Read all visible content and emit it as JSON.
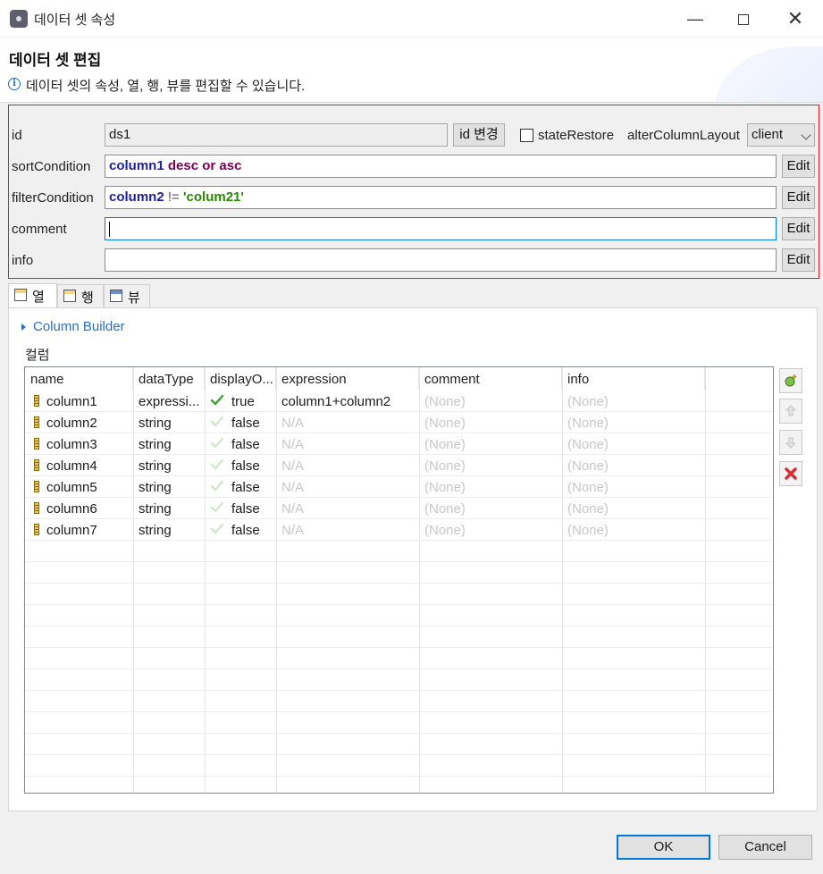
{
  "window": {
    "title": "데이터 셋 속성"
  },
  "header": {
    "title": "데이터 셋 편집",
    "description": "데이터 셋의 속성, 열, 행, 뷰를 편집할 수 있습니다."
  },
  "props": {
    "id_label": "id",
    "id_value": "ds1",
    "id_change_button": "id 변경",
    "state_restore_label": "stateRestore",
    "state_restore_checked": false,
    "alter_column_layout_label": "alterColumnLayout",
    "alter_column_layout_value": "client",
    "sort_label": "sortCondition",
    "sort_tokens": {
      "col": "column1",
      "desc": "desc",
      "or": "or",
      "asc": "asc"
    },
    "filter_label": "filterCondition",
    "filter_tokens": {
      "col": "column2",
      "op": "!=",
      "val": "'colum21'"
    },
    "comment_label": "comment",
    "comment_value": "",
    "info_label": "info",
    "info_value": "",
    "edit_button": "Edit"
  },
  "tabs": [
    {
      "label": "열",
      "active": true
    },
    {
      "label": "행",
      "active": false
    },
    {
      "label": "뷰",
      "active": false
    }
  ],
  "columns_panel": {
    "builder_label": "Column Builder",
    "group_label": "컬럼",
    "headers": [
      "name",
      "dataType",
      "displayO...",
      "expression",
      "comment",
      "info"
    ],
    "rows": [
      {
        "name": "column1",
        "dataType": "expressi...",
        "display": "true",
        "expression": "column1+column2",
        "comment": "(None)",
        "info": "(None)"
      },
      {
        "name": "column2",
        "dataType": "string",
        "display": "false",
        "expression": "N/A",
        "comment": "(None)",
        "info": "(None)"
      },
      {
        "name": "column3",
        "dataType": "string",
        "display": "false",
        "expression": "N/A",
        "comment": "(None)",
        "info": "(None)"
      },
      {
        "name": "column4",
        "dataType": "string",
        "display": "false",
        "expression": "N/A",
        "comment": "(None)",
        "info": "(None)"
      },
      {
        "name": "column5",
        "dataType": "string",
        "display": "false",
        "expression": "N/A",
        "comment": "(None)",
        "info": "(None)"
      },
      {
        "name": "column6",
        "dataType": "string",
        "display": "false",
        "expression": "N/A",
        "comment": "(None)",
        "info": "(None)"
      },
      {
        "name": "column7",
        "dataType": "string",
        "display": "false",
        "expression": "N/A",
        "comment": "(None)",
        "info": "(None)"
      }
    ]
  },
  "footer": {
    "ok": "OK",
    "cancel": "Cancel"
  },
  "colors": {
    "accent": "#0078d7",
    "highlight_border": "#e02020",
    "link": "#2a6ebd"
  }
}
